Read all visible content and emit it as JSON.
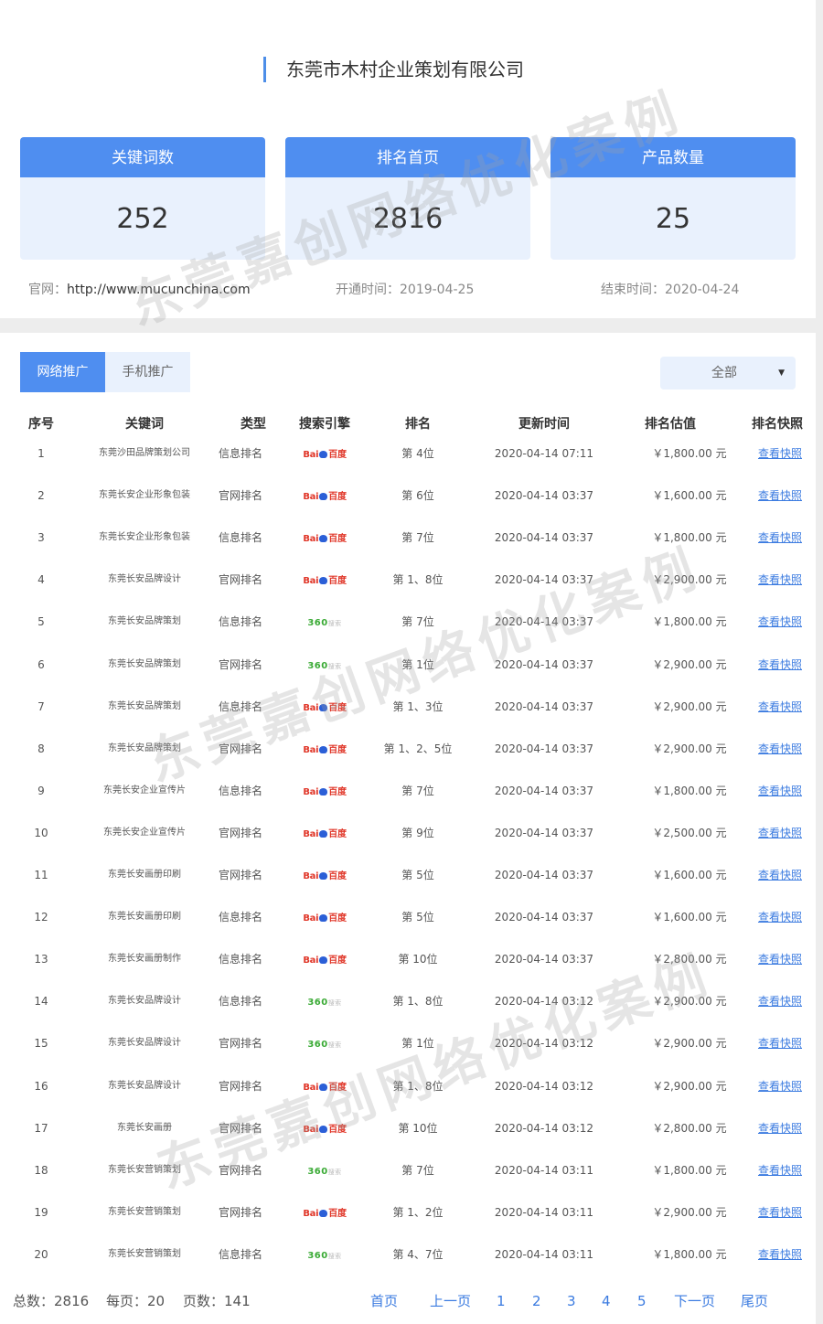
{
  "company": "东莞市木村企业策划有限公司",
  "stats": [
    {
      "label": "关键词数",
      "value": "252"
    },
    {
      "label": "排名首页",
      "value": "2816"
    },
    {
      "label": "产品数量",
      "value": "25"
    }
  ],
  "meta": {
    "site_label": "官网：",
    "site_url": "http://www.mucunchina.com",
    "start_label": "开通时间：",
    "start_date": "2019-04-25",
    "end_label": "结束时间：",
    "end_date": "2020-04-24"
  },
  "tabs": [
    "网络推广",
    "手机推广"
  ],
  "filter": {
    "value": "全部"
  },
  "table": {
    "headers": [
      "序号",
      "关键词",
      "类型",
      "搜索引擎",
      "排名",
      "更新时间",
      "排名估值",
      "排名快照"
    ],
    "rows": [
      {
        "idx": "1",
        "kw": "东莞沙田品牌策划公司",
        "type": "信息排名",
        "engine": "baidu",
        "rank": "第 4位",
        "time": "2020-04-14 07:11",
        "price": "￥1,800.00 元",
        "snap": "查看快照"
      },
      {
        "idx": "2",
        "kw": "东莞长安企业形象包装",
        "type": "官网排名",
        "engine": "baidu",
        "rank": "第 6位",
        "time": "2020-04-14 03:37",
        "price": "￥1,600.00 元",
        "snap": "查看快照"
      },
      {
        "idx": "3",
        "kw": "东莞长安企业形象包装",
        "type": "信息排名",
        "engine": "baidu",
        "rank": "第 7位",
        "time": "2020-04-14 03:37",
        "price": "￥1,800.00 元",
        "snap": "查看快照"
      },
      {
        "idx": "4",
        "kw": "东莞长安品牌设计",
        "type": "官网排名",
        "engine": "baidu",
        "rank": "第 1、8位",
        "time": "2020-04-14 03:37",
        "price": "￥2,900.00 元",
        "snap": "查看快照"
      },
      {
        "idx": "5",
        "kw": "东莞长安品牌策划",
        "type": "信息排名",
        "engine": "360",
        "rank": "第 7位",
        "time": "2020-04-14 03:37",
        "price": "￥1,800.00 元",
        "snap": "查看快照"
      },
      {
        "idx": "6",
        "kw": "东莞长安品牌策划",
        "type": "官网排名",
        "engine": "360",
        "rank": "第 1位",
        "time": "2020-04-14 03:37",
        "price": "￥2,900.00 元",
        "snap": "查看快照"
      },
      {
        "idx": "7",
        "kw": "东莞长安品牌策划",
        "type": "信息排名",
        "engine": "baidu",
        "rank": "第 1、3位",
        "time": "2020-04-14 03:37",
        "price": "￥2,900.00 元",
        "snap": "查看快照"
      },
      {
        "idx": "8",
        "kw": "东莞长安品牌策划",
        "type": "官网排名",
        "engine": "baidu",
        "rank": "第 1、2、5位",
        "time": "2020-04-14 03:37",
        "price": "￥2,900.00 元",
        "snap": "查看快照"
      },
      {
        "idx": "9",
        "kw": "东莞长安企业宣传片",
        "type": "信息排名",
        "engine": "baidu",
        "rank": "第 7位",
        "time": "2020-04-14 03:37",
        "price": "￥1,800.00 元",
        "snap": "查看快照"
      },
      {
        "idx": "10",
        "kw": "东莞长安企业宣传片",
        "type": "官网排名",
        "engine": "baidu",
        "rank": "第 9位",
        "time": "2020-04-14 03:37",
        "price": "￥2,500.00 元",
        "snap": "查看快照"
      },
      {
        "idx": "11",
        "kw": "东莞长安画册印刷",
        "type": "官网排名",
        "engine": "baidu",
        "rank": "第 5位",
        "time": "2020-04-14 03:37",
        "price": "￥1,600.00 元",
        "snap": "查看快照"
      },
      {
        "idx": "12",
        "kw": "东莞长安画册印刷",
        "type": "信息排名",
        "engine": "baidu",
        "rank": "第 5位",
        "time": "2020-04-14 03:37",
        "price": "￥1,600.00 元",
        "snap": "查看快照"
      },
      {
        "idx": "13",
        "kw": "东莞长安画册制作",
        "type": "信息排名",
        "engine": "baidu",
        "rank": "第 10位",
        "time": "2020-04-14 03:37",
        "price": "￥2,800.00 元",
        "snap": "查看快照"
      },
      {
        "idx": "14",
        "kw": "东莞长安品牌设计",
        "type": "信息排名",
        "engine": "360",
        "rank": "第 1、8位",
        "time": "2020-04-14 03:12",
        "price": "￥2,900.00 元",
        "snap": "查看快照"
      },
      {
        "idx": "15",
        "kw": "东莞长安品牌设计",
        "type": "官网排名",
        "engine": "360",
        "rank": "第 1位",
        "time": "2020-04-14 03:12",
        "price": "￥2,900.00 元",
        "snap": "查看快照"
      },
      {
        "idx": "16",
        "kw": "东莞长安品牌设计",
        "type": "官网排名",
        "engine": "baidu",
        "rank": "第 1、8位",
        "time": "2020-04-14 03:12",
        "price": "￥2,900.00 元",
        "snap": "查看快照"
      },
      {
        "idx": "17",
        "kw": "东莞长安画册",
        "type": "官网排名",
        "engine": "baidu",
        "rank": "第 10位",
        "time": "2020-04-14 03:12",
        "price": "￥2,800.00 元",
        "snap": "查看快照"
      },
      {
        "idx": "18",
        "kw": "东莞长安营销策划",
        "type": "官网排名",
        "engine": "360",
        "rank": "第 7位",
        "time": "2020-04-14 03:11",
        "price": "￥1,800.00 元",
        "snap": "查看快照"
      },
      {
        "idx": "19",
        "kw": "东莞长安营销策划",
        "type": "官网排名",
        "engine": "baidu",
        "rank": "第 1、2位",
        "time": "2020-04-14 03:11",
        "price": "￥2,900.00 元",
        "snap": "查看快照"
      },
      {
        "idx": "20",
        "kw": "东莞长安营销策划",
        "type": "信息排名",
        "engine": "360",
        "rank": "第 4、7位",
        "time": "2020-04-14 03:11",
        "price": "￥1,800.00 元",
        "snap": "查看快照"
      }
    ]
  },
  "engines": {
    "baidu": {
      "text_a": "Bai",
      "text_b": "百度",
      "color": "#e03628"
    },
    "360": {
      "text_a": "360",
      "text_b": "搜索",
      "color": "#3aaa35"
    }
  },
  "footer": {
    "total": "总数：2816",
    "per_page": "每页：20",
    "pages": "页数：141"
  },
  "pager": {
    "first": "首页",
    "prev": "上一页",
    "pages": [
      "1",
      "2",
      "3",
      "4",
      "5"
    ],
    "next": "下一页",
    "last": "尾页"
  },
  "watermark": "东莞嘉创网络优化案例"
}
